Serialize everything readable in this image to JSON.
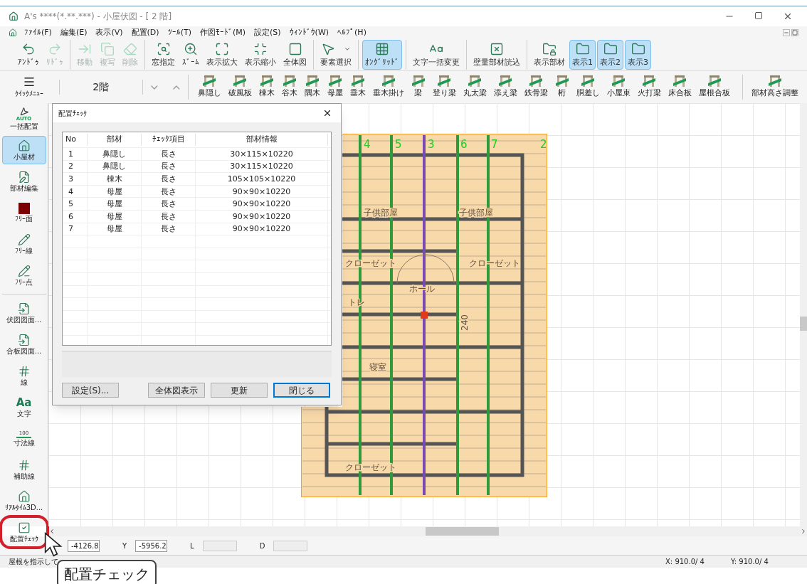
{
  "window": {
    "title": "A's ****(*.**.***) - 小屋伏図 - [ 2 階]"
  },
  "menu": [
    "ﾌｧｲﾙ(F)",
    "編集(E)",
    "表示(V)",
    "配置(D)",
    "ﾂｰﾙ(T)",
    "作図ﾓｰﾄﾞ(M)",
    "設定(S)",
    "ｳｨﾝﾄﾞｳ(W)",
    "ﾍﾙﾌﾟ(H)"
  ],
  "toolbar": [
    [
      {
        "label": "ｱﾝﾄﾞｩ",
        "disabled": false,
        "selected": false
      },
      {
        "label": "ﾘﾄﾞｩ",
        "disabled": true,
        "selected": false
      }
    ],
    [
      {
        "label": "移動",
        "disabled": true,
        "selected": false
      },
      {
        "label": "複写",
        "disabled": true,
        "selected": false
      },
      {
        "label": "削除",
        "disabled": true,
        "selected": false
      }
    ],
    [
      {
        "label": "窓指定",
        "disabled": false,
        "selected": false
      },
      {
        "label": "ｽﾞｰﾑ",
        "disabled": false,
        "selected": false
      },
      {
        "label": "表示拡大",
        "disabled": false,
        "selected": false
      },
      {
        "label": "表示縮小",
        "disabled": false,
        "selected": false
      },
      {
        "label": "全体図",
        "disabled": false,
        "selected": false
      }
    ],
    [
      {
        "label": "要素選択",
        "disabled": false,
        "selected": false
      }
    ],
    [
      {
        "label": "ｵﾝｸﾞﾘｯﾄﾞ",
        "disabled": false,
        "selected": true
      }
    ],
    [
      {
        "label": "文字一括変更",
        "disabled": false,
        "selected": false
      }
    ],
    [
      {
        "label": "壁量部材読込",
        "disabled": false,
        "selected": false
      }
    ],
    [
      {
        "label": "表示部材",
        "disabled": false,
        "selected": false
      },
      {
        "label": "表示1",
        "disabled": false,
        "selected": true
      },
      {
        "label": "表示2",
        "disabled": false,
        "selected": true
      },
      {
        "label": "表示3",
        "disabled": false,
        "selected": true
      }
    ]
  ],
  "quick_menu": {
    "label": "ｸｲｯｸﾒﾆｭｰ"
  },
  "floor": {
    "value": "2階"
  },
  "members": [
    "鼻隠し",
    "破風板",
    "棟木",
    "谷木",
    "隅木",
    "母屋",
    "垂木",
    "垂木掛け",
    "梁",
    "登り梁",
    "丸太梁",
    "添え梁",
    "鉄骨梁",
    "桁",
    "胴差し",
    "小屋束",
    "火打梁",
    "床合板",
    "屋根合板"
  ],
  "height_adjust": {
    "label": "部材高さ調整"
  },
  "sidebar": [
    [
      {
        "label": "一括配置",
        "icon_text": "AUTO",
        "selected": false,
        "highlighted": false
      },
      {
        "label": "小屋材",
        "selected": true,
        "highlighted": false
      },
      {
        "label": "部材編集",
        "selected": false,
        "highlighted": false
      },
      {
        "label": "ﾌﾘｰ面",
        "selected": false,
        "highlighted": false
      },
      {
        "label": "ﾌﾘｰ線",
        "selected": false,
        "highlighted": false
      },
      {
        "label": "ﾌﾘｰ点",
        "selected": false,
        "highlighted": false
      }
    ],
    [
      {
        "label": "伏図図面...",
        "selected": false,
        "highlighted": false
      },
      {
        "label": "合板図面...",
        "selected": false,
        "highlighted": false
      },
      {
        "label": "線",
        "selected": false,
        "highlighted": false
      },
      {
        "label": "文字",
        "icon_text": "Aa",
        "selected": false,
        "highlighted": false
      },
      {
        "label": "寸法線",
        "icon_text": "100",
        "selected": false,
        "highlighted": false
      },
      {
        "label": "補助線",
        "selected": false,
        "highlighted": false
      },
      {
        "label": "ﾘｱﾙﾀｲﾑ3D...",
        "selected": false,
        "highlighted": false
      },
      {
        "label": "配置ﾁｪｯｸ",
        "selected": false,
        "highlighted": true
      }
    ]
  ],
  "plan": {
    "grid_numbers": [
      "4",
      "5",
      "3",
      "6",
      "7",
      "2"
    ],
    "rooms": [
      "子供部屋",
      "子供部屋",
      "クローゼット",
      "クローゼット",
      "ホール",
      "トレ",
      "240",
      "寝室",
      "クローゼット"
    ]
  },
  "dialog": {
    "title": "配置ﾁｪｯｸ",
    "columns": [
      "No",
      "部材",
      "ﾁｪｯｸ項目",
      "部材情報"
    ],
    "rows": [
      [
        "1",
        "鼻隠し",
        "長さ",
        "30×115×10220"
      ],
      [
        "2",
        "鼻隠し",
        "長さ",
        "30×115×10220"
      ],
      [
        "3",
        "棟木",
        "長さ",
        "105×105×10220"
      ],
      [
        "4",
        "母屋",
        "長さ",
        "90×90×10220"
      ],
      [
        "5",
        "母屋",
        "長さ",
        "90×90×10220"
      ],
      [
        "6",
        "母屋",
        "長さ",
        "90×90×10220"
      ],
      [
        "7",
        "母屋",
        "長さ",
        "90×90×10220"
      ]
    ],
    "buttons": [
      {
        "label": "設定(S)...",
        "default": false
      },
      {
        "label": "全体図表示",
        "default": false
      },
      {
        "label": "更新",
        "default": false
      },
      {
        "label": "閉じる",
        "default": true
      }
    ]
  },
  "coordinates": {
    "x_value": "-4126.8",
    "y_label": "Y",
    "y_value": "-5956.2",
    "l_label": "L",
    "d_label": "D"
  },
  "status_bar": {
    "message": "屋根を指示して",
    "x": "X: 910.0/ 4",
    "y": "Y: 910.0/ 4"
  },
  "callout": {
    "text": "配置チェック"
  }
}
